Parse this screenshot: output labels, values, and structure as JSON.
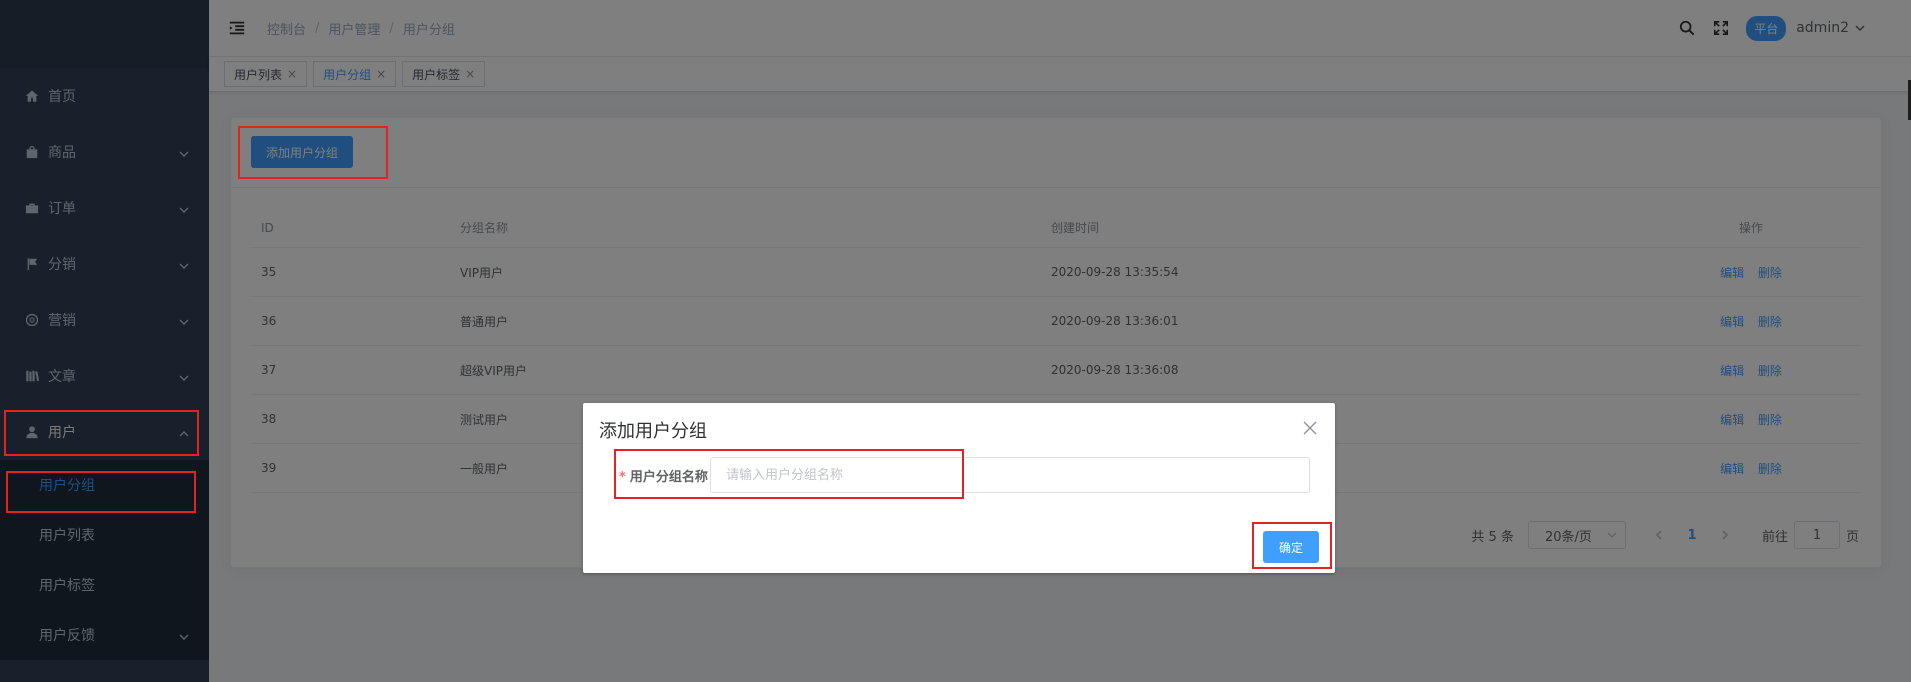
{
  "sidebar": {
    "items": [
      {
        "label": "首页",
        "icon": "home-icon"
      },
      {
        "label": "商品",
        "icon": "shopping-bag-icon"
      },
      {
        "label": "订单",
        "icon": "briefcase-icon"
      },
      {
        "label": "分销",
        "icon": "flag-icon"
      },
      {
        "label": "营销",
        "icon": "lifebuoy-icon"
      },
      {
        "label": "文章",
        "icon": "library-icon"
      },
      {
        "label": "用户",
        "icon": "user-icon"
      }
    ],
    "subitems": [
      {
        "label": "用户分组"
      },
      {
        "label": "用户列表"
      },
      {
        "label": "用户标签"
      },
      {
        "label": "用户反馈"
      }
    ]
  },
  "header": {
    "breadcrumb": [
      "控制台",
      "用户管理",
      "用户分组"
    ],
    "platform_badge": "平台",
    "username": "admin2"
  },
  "tags": [
    {
      "label": "用户列表"
    },
    {
      "label": "用户分组"
    },
    {
      "label": "用户标签"
    }
  ],
  "main": {
    "add_button": "添加用户分组",
    "columns": [
      "ID",
      "分组名称",
      "创建时间",
      "操作"
    ],
    "rows": [
      {
        "id": "35",
        "name": "VIP用户",
        "created": "2020-09-28 13:35:54"
      },
      {
        "id": "36",
        "name": "普通用户",
        "created": "2020-09-28 13:36:01"
      },
      {
        "id": "37",
        "name": "超级VIP用户",
        "created": "2020-09-28 13:36:08"
      },
      {
        "id": "38",
        "name": "测试用户",
        "created": ""
      },
      {
        "id": "39",
        "name": "一般用户",
        "created": ""
      }
    ],
    "row_ops": {
      "edit": "编辑",
      "delete": "删除"
    },
    "pagination": {
      "total": "共 5 条",
      "page_size": "20条/页",
      "current_page": "1",
      "goto_prefix": "前往",
      "goto_value": "1",
      "goto_suffix": "页"
    }
  },
  "dialog": {
    "title": "添加用户分组",
    "required_mark": "*",
    "field_label": "用户分组名称",
    "field_placeholder": "请输入用户分组名称",
    "field_value": "",
    "confirm": "确定"
  },
  "colors": {
    "sidebar_bg": "#304156",
    "primary": "#409eff",
    "highlight_box": "#e02424"
  }
}
